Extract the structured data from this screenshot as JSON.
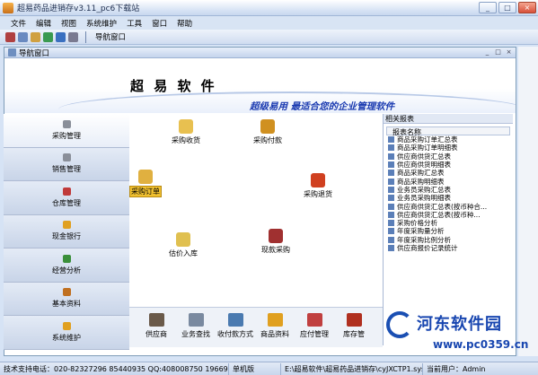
{
  "window": {
    "title": "超易药品进销存v3.11_pc6下载站",
    "controls": [
      "_",
      "□",
      "×"
    ]
  },
  "menu": [
    "文件",
    "编辑",
    "视图",
    "系统维护",
    "工具",
    "窗口",
    "帮助"
  ],
  "toolbar": {
    "nav_label": "导航窗口"
  },
  "child_window": {
    "title": "导航窗口",
    "controls": [
      "_",
      "□",
      "×"
    ]
  },
  "banner": {
    "company": "超 易 软 件",
    "slogan": "超级易用  最适合您的企业管理软件"
  },
  "sidebar": {
    "items": [
      {
        "label": "采购管理",
        "icon": "gear-icon",
        "color": "#8a8f99"
      },
      {
        "label": "销售管理",
        "icon": "gear-icon",
        "color": "#8a8f99"
      },
      {
        "label": "仓库管理",
        "icon": "warehouse-icon",
        "color": "#c03a3a"
      },
      {
        "label": "现金银行",
        "icon": "cash-icon",
        "color": "#e0a020"
      },
      {
        "label": "经营分析",
        "icon": "chart-icon",
        "color": "#3a8f3a"
      },
      {
        "label": "基本资料",
        "icon": "book-icon",
        "color": "#c07020"
      },
      {
        "label": "系统维护",
        "icon": "tools-icon",
        "color": "#e0a020"
      }
    ]
  },
  "flow": {
    "nodes": [
      {
        "label": "采购收货",
        "icon": "receive-icon",
        "color": "#e8c050"
      },
      {
        "label": "采购付款",
        "icon": "payment-icon",
        "color": "#d09020"
      },
      {
        "label": "采购订单",
        "icon": "order-icon",
        "color": "#e0b040"
      },
      {
        "label": "采购退货",
        "icon": "return-icon",
        "color": "#d04020"
      },
      {
        "label": "估价入库",
        "icon": "stock-in-icon",
        "color": "#e0c050"
      },
      {
        "label": "现款采购",
        "icon": "cash-purchase-icon",
        "color": "#a03030"
      }
    ]
  },
  "dock": {
    "items": [
      {
        "label": "供应商",
        "icon": "supplier-icon",
        "color": "#6a5a4a"
      },
      {
        "label": "业务查找",
        "icon": "search-icon",
        "color": "#7a8aa0"
      },
      {
        "label": "收付款方式",
        "icon": "payment-method-icon",
        "color": "#4a7ab0"
      },
      {
        "label": "商品资料",
        "icon": "goods-icon",
        "color": "#e0a020"
      },
      {
        "label": "应付管理",
        "icon": "payable-icon",
        "color": "#c04040"
      },
      {
        "label": "库存管",
        "icon": "inventory-icon",
        "color": "#b03020"
      }
    ]
  },
  "reports": {
    "title": "相关报表",
    "header": "报表名称",
    "items": [
      "商品采购订单汇总表",
      "商品采购订单明细表",
      "供应商供货汇总表",
      "供应商供货明细表",
      "商品采购汇总表",
      "商品采购明细表",
      "业务员采购汇总表",
      "业务员采购明细表",
      "供应商供货汇总表(按币种合...",
      "供应商供货汇总表(按币种...",
      "采购价格分析",
      "年度采购量分析",
      "年度采购比例分析",
      "供应商报价记录统计"
    ]
  },
  "status": {
    "support": "技术支持电话：020-82327296 85440935 QQ:408008750 19669",
    "mode": "单机版",
    "path": "E:\\超易软件\\超易药品进销存\\cyJXCTP1.sys",
    "user": "当前用户：Admin"
  },
  "watermark": {
    "title": "河东软件园",
    "url": "www.pc0359.cn"
  }
}
